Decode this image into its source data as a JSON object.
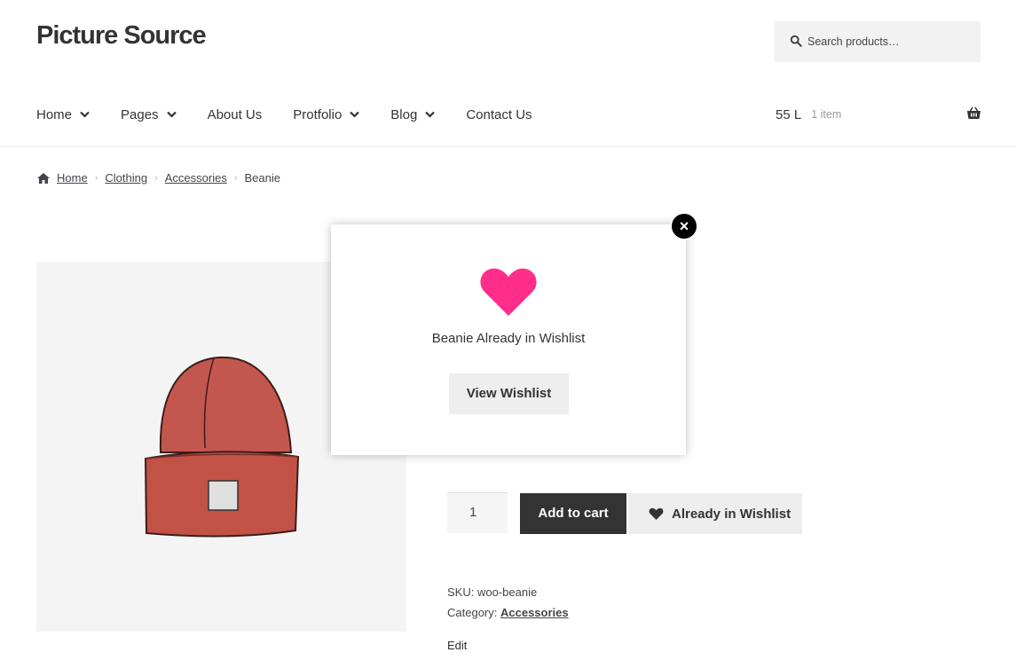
{
  "site": {
    "title": "Picture Source"
  },
  "search": {
    "placeholder": "Search products…"
  },
  "nav": {
    "items": [
      {
        "label": "Home",
        "has_dropdown": true
      },
      {
        "label": "Pages",
        "has_dropdown": true
      },
      {
        "label": "About Us",
        "has_dropdown": false
      },
      {
        "label": "Protfolio",
        "has_dropdown": true
      },
      {
        "label": "Blog",
        "has_dropdown": true
      },
      {
        "label": "Contact Us",
        "has_dropdown": false
      }
    ]
  },
  "cart": {
    "total": "55 L",
    "count": "1 item"
  },
  "breadcrumb": {
    "home": "Home",
    "clothing": "Clothing",
    "accessories": "Accessories",
    "current": "Beanie"
  },
  "product": {
    "quantity": "1",
    "add_to_cart": "Add to cart",
    "wishlist_button": "Already in Wishlist",
    "sku_label": "SKU:",
    "sku_value": "woo-beanie",
    "category_label": "Category:",
    "category_value": "Accessories",
    "edit": "Edit"
  },
  "modal": {
    "message": "Beanie Already in Wishlist",
    "button": "View Wishlist",
    "close": "×"
  },
  "colors": {
    "accent_heart": "#ff2e8a",
    "button_dark": "#333333",
    "beanie_red": "#c0524a"
  },
  "icons": {
    "search": "search-icon",
    "chevron": "chevron-down-icon",
    "cart": "shopping-basket-icon",
    "home": "home-icon",
    "heart": "heart-icon",
    "close": "close-icon"
  }
}
